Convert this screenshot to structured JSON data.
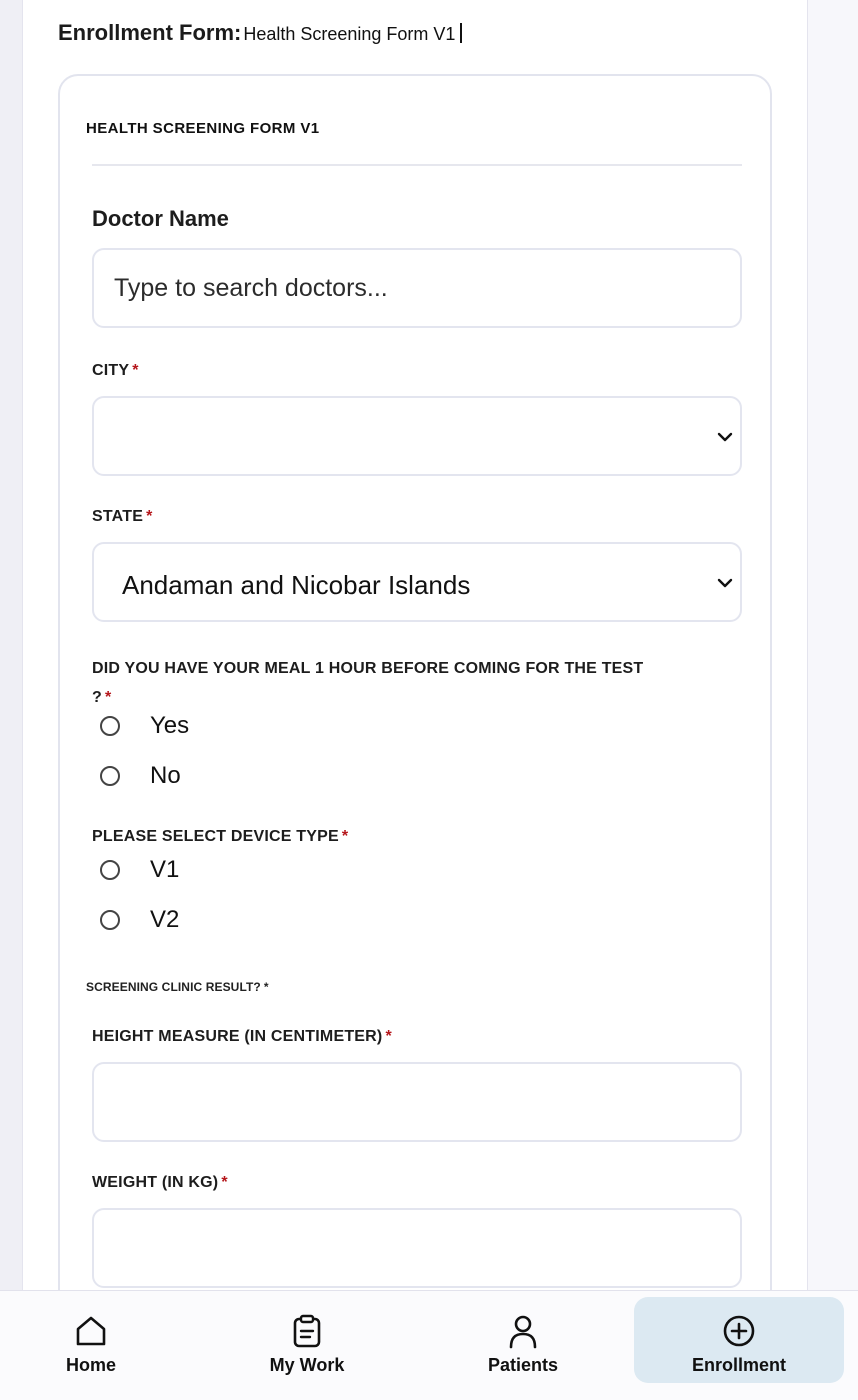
{
  "header": {
    "title": "Enrollment Form:",
    "form_name": "Health Screening Form V1"
  },
  "form": {
    "card_title": "HEALTH SCREENING FORM V1",
    "doctor": {
      "label": "Doctor Name",
      "placeholder": "Type to search doctors..."
    },
    "city": {
      "label": "CITY",
      "required_mark": "*",
      "value": ""
    },
    "state": {
      "label": "STATE",
      "required_mark": "*",
      "value": "Andaman and Nicobar Islands"
    },
    "meal": {
      "label_line1": "DID YOU HAVE YOUR MEAL 1 HOUR BEFORE COMING FOR THE TEST",
      "label_line2": "?",
      "required_mark": "*",
      "options": [
        "Yes",
        "No"
      ]
    },
    "device": {
      "label": "PLEASE SELECT DEVICE TYPE",
      "required_mark": "*",
      "options": [
        "V1",
        "V2"
      ]
    },
    "clinic_result": {
      "label": "SCREENING CLINIC RESULT?",
      "required_mark": "*"
    },
    "height": {
      "label": "HEIGHT MEASURE (IN CENTIMETER)",
      "required_mark": "*",
      "value": ""
    },
    "weight": {
      "label": "WEIGHT (IN KG)",
      "required_mark": "*",
      "value": ""
    }
  },
  "nav": {
    "items": [
      {
        "label": "Home",
        "icon": "home-icon"
      },
      {
        "label": "My Work",
        "icon": "clipboard-icon"
      },
      {
        "label": "Patients",
        "icon": "person-icon"
      },
      {
        "label": "Enrollment",
        "icon": "plus-circle-icon",
        "active": true
      }
    ]
  },
  "colors": {
    "required": "#b5161b",
    "active_nav_bg": "#dce9f2"
  }
}
